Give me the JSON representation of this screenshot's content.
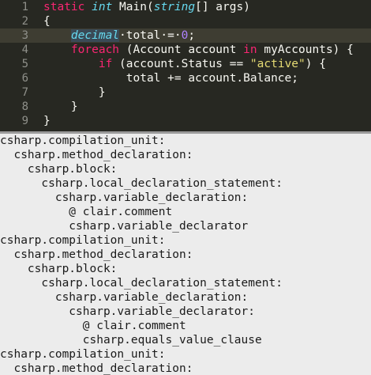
{
  "editor": {
    "current_line": 3,
    "lines": [
      {
        "num": "1",
        "tokens": [
          {
            "t": "static",
            "c": "kw"
          },
          {
            "t": " "
          },
          {
            "t": "int",
            "c": "type"
          },
          {
            "t": " Main("
          },
          {
            "t": "string",
            "c": "type"
          },
          {
            "t": "[] args)"
          }
        ]
      },
      {
        "num": "2",
        "tokens": [
          {
            "t": "{"
          }
        ]
      },
      {
        "num": "3",
        "tokens": [
          {
            "t": "    "
          },
          {
            "t": "decimal",
            "c": "hl"
          },
          {
            "t": "·",
            "c": "ws"
          },
          {
            "t": "total"
          },
          {
            "t": "·",
            "c": "ws"
          },
          {
            "t": "="
          },
          {
            "t": "·",
            "c": "ws"
          },
          {
            "t": "0",
            "c": "num"
          },
          {
            "t": ";"
          }
        ]
      },
      {
        "num": "4",
        "tokens": [
          {
            "t": "    "
          },
          {
            "t": "foreach",
            "c": "kw"
          },
          {
            "t": " (Account account "
          },
          {
            "t": "in",
            "c": "kw"
          },
          {
            "t": " myAccounts) {"
          }
        ]
      },
      {
        "num": "5",
        "tokens": [
          {
            "t": "        "
          },
          {
            "t": "if",
            "c": "kw"
          },
          {
            "t": " (account.Status == "
          },
          {
            "t": "\"active\"",
            "c": "str"
          },
          {
            "t": ") {"
          }
        ]
      },
      {
        "num": "6",
        "tokens": [
          {
            "t": "            total += account.Balance;"
          }
        ]
      },
      {
        "num": "7",
        "tokens": [
          {
            "t": "        }"
          }
        ]
      },
      {
        "num": "8",
        "tokens": [
          {
            "t": "    }"
          }
        ]
      },
      {
        "num": "9",
        "tokens": [
          {
            "t": "}"
          }
        ]
      }
    ]
  },
  "output": {
    "lines": [
      "csharp.compilation_unit:",
      "  csharp.method_declaration:",
      "    csharp.block:",
      "      csharp.local_declaration_statement:",
      "        csharp.variable_declaration:",
      "          @ clair.comment",
      "          csharp.variable_declarator",
      "csharp.compilation_unit:",
      "  csharp.method_declaration:",
      "    csharp.block:",
      "      csharp.local_declaration_statement:",
      "        csharp.variable_declaration:",
      "          csharp.variable_declarator:",
      "            @ clair.comment",
      "            csharp.equals_value_clause",
      "csharp.compilation_unit:",
      "  csharp.method_declaration:"
    ]
  },
  "colors": {
    "editor_bg": "#272822",
    "keyword": "#f92672",
    "type": "#66d9ef",
    "string": "#e6db74",
    "number": "#ae81ff",
    "output_bg": "#ececec"
  }
}
